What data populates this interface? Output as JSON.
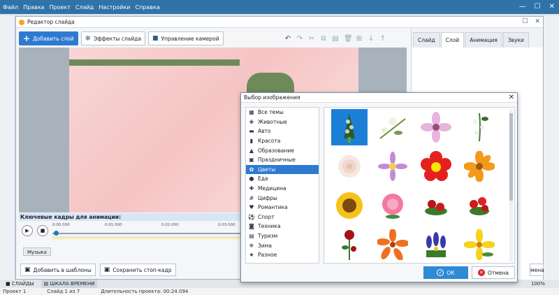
{
  "menubar": {
    "items": [
      "Файл",
      "Правка",
      "Проект",
      "Слайд",
      "Настройки",
      "Справка"
    ]
  },
  "editor": {
    "title": "Редактор слайда",
    "toolbar": {
      "add_layer": "Добавить слой",
      "slide_effects": "Эффекты слайда",
      "camera_control": "Управление камерой"
    },
    "right_tabs": [
      "Слайд",
      "Слой",
      "Анимация",
      "Звуки"
    ],
    "active_right_tab": "Слой",
    "keyframes": {
      "header": "Ключевые кадры для анимации:",
      "ticks": [
        "0:00.000",
        "0:01.000",
        "0:02.000",
        "0:03.000"
      ],
      "music_label": "Музыка"
    },
    "bottom": {
      "add_to_templates": "Добавить в шаблоны",
      "save_frame": "Сохранить стоп-кадр",
      "cancel_partial": "мена"
    }
  },
  "dialog": {
    "title": "Выбор изображения",
    "categories": [
      {
        "label": "Все темы",
        "icon": "grid-icon"
      },
      {
        "label": "Животные",
        "icon": "paw-icon"
      },
      {
        "label": "Авто",
        "icon": "car-icon"
      },
      {
        "label": "Красота",
        "icon": "lipstick-icon"
      },
      {
        "label": "Образование",
        "icon": "graduation-cap-icon"
      },
      {
        "label": "Праздничные",
        "icon": "gift-icon"
      },
      {
        "label": "Цветы",
        "icon": "flower-icon"
      },
      {
        "label": "Еда",
        "icon": "apple-icon"
      },
      {
        "label": "Медицина",
        "icon": "medical-cross-icon"
      },
      {
        "label": "Цифры",
        "icon": "numbers-icon"
      },
      {
        "label": "Романтика",
        "icon": "heart-icon"
      },
      {
        "label": "Спорт",
        "icon": "ball-icon"
      },
      {
        "label": "Техника",
        "icon": "camera-icon"
      },
      {
        "label": "Туризм",
        "icon": "suitcase-icon"
      },
      {
        "label": "Зима",
        "icon": "snowflake-icon"
      },
      {
        "label": "Разное",
        "icon": "star-icon"
      }
    ],
    "active_category": "Цветы",
    "ok_label": "ОК",
    "cancel_label": "Отмена",
    "accent": "#2f7ad1"
  },
  "status": {
    "slides_tab": "СЛАЙДЫ",
    "timeline_tab": "ШКАЛА ВРЕМЕНИ",
    "project": "Проект 1",
    "slide": "Слайд 1 из 7",
    "duration": "Длительность проекта: 00:24.094",
    "zoom": "100%"
  }
}
